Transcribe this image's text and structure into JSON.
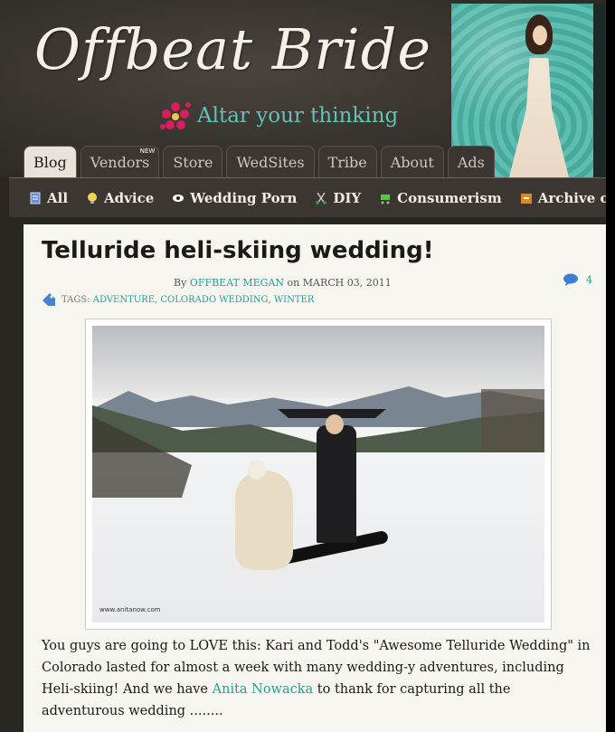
{
  "header": {
    "logo_text": "Offbeat Bride",
    "tagline": "Altar your thinking"
  },
  "tabs": [
    {
      "label": "Blog",
      "active": true
    },
    {
      "label": "Vendors",
      "badge": "NEW"
    },
    {
      "label": "Store"
    },
    {
      "label": "WedSites"
    },
    {
      "label": "Tribe"
    },
    {
      "label": "About"
    },
    {
      "label": "Ads"
    }
  ],
  "subnav": [
    {
      "label": "All",
      "icon": "document-icon"
    },
    {
      "label": "Advice",
      "icon": "lightbulb-icon"
    },
    {
      "label": "Wedding Porn",
      "icon": "eye-icon"
    },
    {
      "label": "DIY",
      "icon": "scissors-icon"
    },
    {
      "label": "Consumerism",
      "icon": "cart-icon"
    },
    {
      "label": "Archive of Awe",
      "icon": "archive-icon"
    }
  ],
  "post": {
    "title": "Telluride heli-skiing wedding!",
    "by": "By",
    "author": "OFFBEAT MEGAN",
    "on": "on MARCH 03, 2011",
    "comment_count": "4",
    "tags_label": "TAGS:",
    "tags": [
      "ADVENTURE",
      "COLORADO WEDDING",
      "WINTER"
    ],
    "photo_credit": "www.anitanow.com",
    "body_1": "You guys are going to LOVE this: Kari and Todd's \"Awesome Telluride Wedding\" in Colorado lasted for almost a week with many wedding-y adventures, including Heli-skiing! And we have ",
    "body_link": "Anita Nowacka",
    "body_2": " to thank for capturing all the adventurous wedding  ........"
  },
  "colors": {
    "accent": "#2a9d8f",
    "header_bg": "#34302b",
    "content_bg": "#f7f5f0"
  }
}
